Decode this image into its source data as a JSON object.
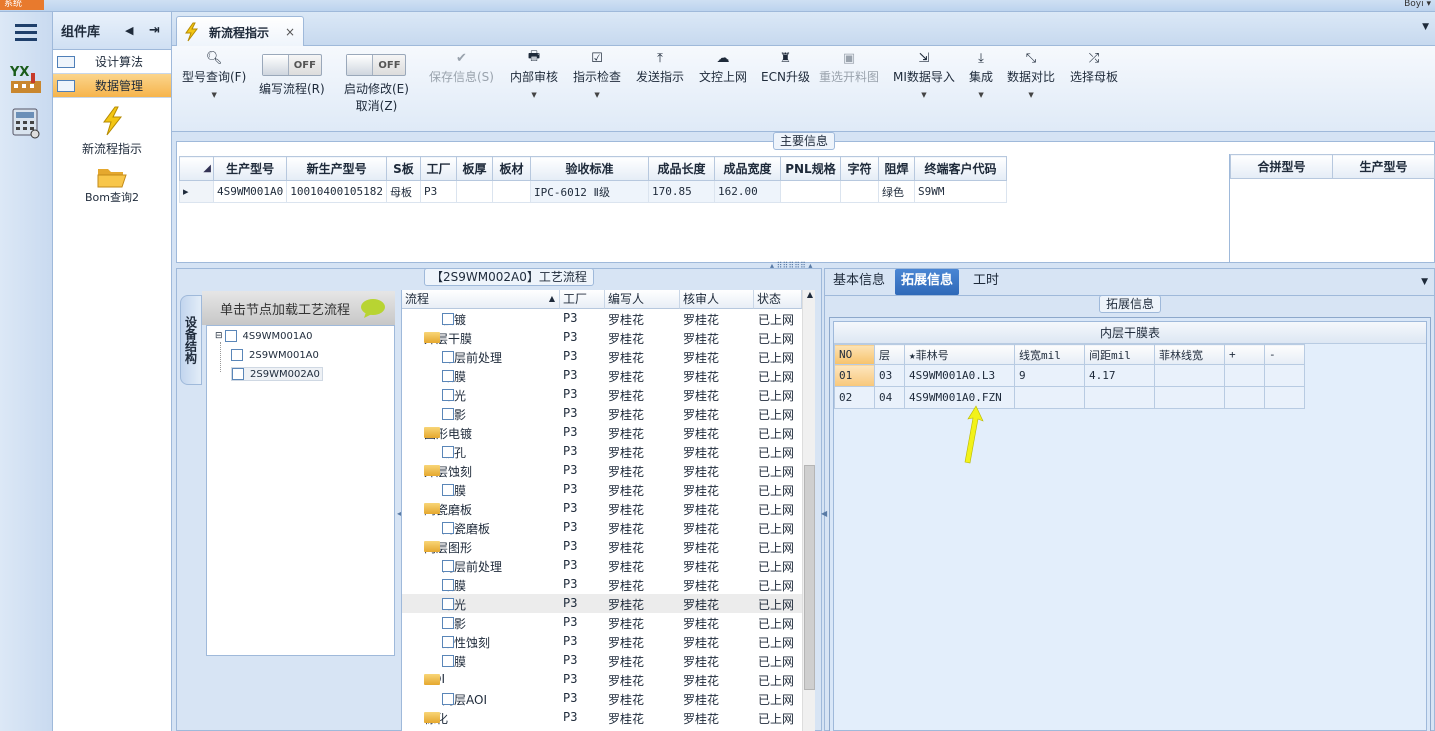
{
  "topbar": {
    "system_label": "系统",
    "user_label": "Boyi ▾"
  },
  "sidebar": {
    "title": "组件库",
    "items": [
      {
        "label": "设计算法"
      },
      {
        "label": "数据管理"
      }
    ],
    "tools": [
      {
        "label": "新流程指示"
      },
      {
        "label": "Bom查询2"
      }
    ]
  },
  "tab": {
    "title": "新流程指示",
    "close": "×"
  },
  "ribbon": {
    "query": "型号查询(F)",
    "edit_label": "编写流程(R)",
    "edit_toggle": "OFF",
    "modify_label1": "启动修改(E)",
    "modify_label2": "取消(Z)",
    "modify_toggle": "OFF",
    "save": "保存信息(S)",
    "audit": "内部审核",
    "check": "指示检查",
    "send": "发送指示",
    "upload": "文控上网",
    "ecn": "ECN升级",
    "material": "重选开料图",
    "mi_import": "MI数据导入",
    "integrate": "集成",
    "compare": "数据对比",
    "mother": "选择母板"
  },
  "main_info": {
    "title": "主要信息",
    "columns": [
      "生产型号",
      "新生产型号",
      "S板",
      "工厂",
      "板厚",
      "板材",
      "验收标准",
      "成品长度",
      "成品宽度",
      "PNL规格",
      "字符",
      "阻焊",
      "终端客户代码"
    ],
    "row": [
      "4S9WM001A0",
      "10010400105182",
      "母板",
      "P3",
      "",
      "",
      "IPC-6012 Ⅱ级",
      "170.85",
      "162.00",
      "",
      "",
      "绿色",
      "S9WM"
    ],
    "merge_columns": [
      "合拼型号",
      "生产型号"
    ]
  },
  "flow": {
    "title": "【2S9WM002A0】工艺流程",
    "side_tab": "设备结构",
    "tree_title": "单击节点加载工艺流程",
    "tree": [
      "4S9WM001A0",
      "2S9WM001A0",
      "2S9WM002A0"
    ],
    "columns": [
      "流程",
      "工厂",
      "编写人",
      "核审人",
      "状态"
    ],
    "rows": [
      {
        "name": "板镀",
        "type": "file",
        "factory": "P3",
        "writer": "罗桂花",
        "auditor": "罗桂花",
        "status": "已上网"
      },
      {
        "name": "外层干膜",
        "type": "folder",
        "factory": "P3",
        "writer": "罗桂花",
        "auditor": "罗桂花",
        "status": "已上网"
      },
      {
        "name": "外层前处理",
        "type": "file",
        "factory": "P3",
        "writer": "罗桂花",
        "auditor": "罗桂花",
        "status": "已上网"
      },
      {
        "name": "贴膜",
        "type": "file",
        "factory": "P3",
        "writer": "罗桂花",
        "auditor": "罗桂花",
        "status": "已上网"
      },
      {
        "name": "曝光",
        "type": "file",
        "factory": "P3",
        "writer": "罗桂花",
        "auditor": "罗桂花",
        "status": "已上网"
      },
      {
        "name": "显影",
        "type": "file",
        "factory": "P3",
        "writer": "罗桂花",
        "auditor": "罗桂花",
        "status": "已上网"
      },
      {
        "name": "图形电镀",
        "type": "folder",
        "factory": "P3",
        "writer": "罗桂花",
        "auditor": "罗桂花",
        "status": "已上网"
      },
      {
        "name": "镀孔",
        "type": "file",
        "factory": "P3",
        "writer": "罗桂花",
        "auditor": "罗桂花",
        "status": "已上网"
      },
      {
        "name": "外层蚀刻",
        "type": "folder",
        "factory": "P3",
        "writer": "罗桂花",
        "auditor": "罗桂花",
        "status": "已上网"
      },
      {
        "name": "退膜",
        "type": "file",
        "factory": "P3",
        "writer": "罗桂花",
        "auditor": "罗桂花",
        "status": "已上网"
      },
      {
        "name": "陶瓷磨板",
        "type": "folder",
        "factory": "P3",
        "writer": "罗桂花",
        "auditor": "罗桂花",
        "status": "已上网"
      },
      {
        "name": "陶瓷磨板",
        "type": "file",
        "factory": "P3",
        "writer": "罗桂花",
        "auditor": "罗桂花",
        "status": "已上网"
      },
      {
        "name": "内层图形",
        "type": "folder",
        "factory": "P3",
        "writer": "罗桂花",
        "auditor": "罗桂花",
        "status": "已上网"
      },
      {
        "name": "内层前处理",
        "type": "file",
        "factory": "P3",
        "writer": "罗桂花",
        "auditor": "罗桂花",
        "status": "已上网"
      },
      {
        "name": "贴膜",
        "type": "file",
        "factory": "P3",
        "writer": "罗桂花",
        "auditor": "罗桂花",
        "status": "已上网"
      },
      {
        "name": "曝光",
        "type": "file",
        "factory": "P3",
        "writer": "罗桂花",
        "auditor": "罗桂花",
        "status": "已上网"
      },
      {
        "name": "显影",
        "type": "file",
        "factory": "P3",
        "writer": "罗桂花",
        "auditor": "罗桂花",
        "status": "已上网"
      },
      {
        "name": "酸性蚀刻",
        "type": "file",
        "factory": "P3",
        "writer": "罗桂花",
        "auditor": "罗桂花",
        "status": "已上网"
      },
      {
        "name": "退膜",
        "type": "file",
        "factory": "P3",
        "writer": "罗桂花",
        "auditor": "罗桂花",
        "status": "已上网"
      },
      {
        "name": "AOI",
        "type": "folder",
        "factory": "P3",
        "writer": "罗桂花",
        "auditor": "罗桂花",
        "status": "已上网"
      },
      {
        "name": "内层AOI",
        "type": "file",
        "factory": "P3",
        "writer": "罗桂花",
        "auditor": "罗桂花",
        "status": "已上网"
      },
      {
        "name": "棕化",
        "type": "folder",
        "factory": "P3",
        "writer": "罗桂花",
        "auditor": "罗桂花",
        "status": "已上网"
      }
    ]
  },
  "right": {
    "tabs": [
      "基本信息",
      "拓展信息",
      "工时"
    ],
    "ext_title": "拓展信息",
    "table_title": "内层干膜表",
    "columns": [
      "NO",
      "层",
      "★菲林号",
      "线宽mil",
      "间距mil",
      "菲林线宽",
      "+",
      "-"
    ],
    "rows": [
      [
        "01",
        "03",
        "4S9WM001A0.L3",
        "9",
        "4.17",
        "",
        "",
        ""
      ],
      [
        "02",
        "04",
        "4S9WM001A0.FZN",
        "",
        "",
        "",
        "",
        ""
      ]
    ]
  },
  "colors": {
    "accent": "#2f69b8",
    "selected_nav": "#f6b44c",
    "arrow": "#f2f21a"
  }
}
